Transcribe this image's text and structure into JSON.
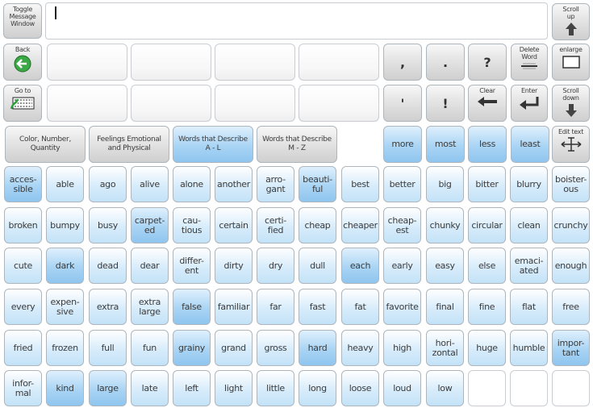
{
  "message": {
    "text": ""
  },
  "controls": {
    "toggle_message_window": {
      "label": "Toggle\nMessage\nWindow",
      "icon": "none"
    },
    "back": {
      "label": "Back",
      "icon": "back-arrow-icon"
    },
    "go_to_keyboard": {
      "label": "Go to",
      "icon": "keyboard-icon"
    },
    "scroll_up": {
      "label": "Scroll\nup",
      "icon": "up-arrow-icon"
    },
    "delete_word": {
      "label": "Delete\nWord",
      "icon": "delete-word-icon"
    },
    "enlarge": {
      "label": "enlarge",
      "icon": "enlarge-window-icon"
    },
    "clear": {
      "label": "Clear",
      "icon": "clear-arrow-icon"
    },
    "enter": {
      "label": "Enter",
      "icon": "enter-arrow-icon"
    },
    "scroll_down": {
      "label": "Scroll\ndown",
      "icon": "down-arrow-icon"
    },
    "edit_text": {
      "label": "Edit text",
      "icon": "text-cursor-icon"
    }
  },
  "punctuation": [
    ",",
    ".",
    "?",
    "'",
    "!"
  ],
  "categories": [
    {
      "label": "Color, Number,\nQuantity",
      "selected": false
    },
    {
      "label": "Feelings Emotional\nand Physical",
      "selected": false
    },
    {
      "label": "Words that Describe\nA - L",
      "selected": true
    },
    {
      "label": "Words that Describe\nM - Z",
      "selected": false
    }
  ],
  "comparatives": [
    "more",
    "most",
    "less",
    "least"
  ],
  "word_grid": [
    [
      {
        "w": "acces-\nsible",
        "s": true
      },
      {
        "w": "able",
        "s": false
      },
      {
        "w": "ago",
        "s": false
      },
      {
        "w": "alive",
        "s": false
      },
      {
        "w": "alone",
        "s": false
      },
      {
        "w": "another",
        "s": false
      },
      {
        "w": "arro-\ngant",
        "s": false
      },
      {
        "w": "beauti-\nful",
        "s": true
      },
      {
        "w": "best",
        "s": false
      },
      {
        "w": "better",
        "s": false
      },
      {
        "w": "big",
        "s": false
      },
      {
        "w": "bitter",
        "s": false
      },
      {
        "w": "blurry",
        "s": false
      },
      {
        "w": "boister-\nous",
        "s": false
      }
    ],
    [
      {
        "w": "broken",
        "s": false
      },
      {
        "w": "bumpy",
        "s": false
      },
      {
        "w": "busy",
        "s": false
      },
      {
        "w": "carpet-\ned",
        "s": true
      },
      {
        "w": "cau-\ntious",
        "s": false
      },
      {
        "w": "certain",
        "s": false
      },
      {
        "w": "certi-\nfied",
        "s": false
      },
      {
        "w": "cheap",
        "s": false
      },
      {
        "w": "cheaper",
        "s": false
      },
      {
        "w": "cheap-\nest",
        "s": false
      },
      {
        "w": "chunky",
        "s": false
      },
      {
        "w": "circular",
        "s": false
      },
      {
        "w": "clean",
        "s": false
      },
      {
        "w": "crunchy",
        "s": false
      }
    ],
    [
      {
        "w": "cute",
        "s": false
      },
      {
        "w": "dark",
        "s": true
      },
      {
        "w": "dead",
        "s": false
      },
      {
        "w": "dear",
        "s": false
      },
      {
        "w": "differ-\nent",
        "s": false
      },
      {
        "w": "dirty",
        "s": false
      },
      {
        "w": "dry",
        "s": false
      },
      {
        "w": "dull",
        "s": false
      },
      {
        "w": "each",
        "s": true
      },
      {
        "w": "early",
        "s": false
      },
      {
        "w": "easy",
        "s": false
      },
      {
        "w": "else",
        "s": false
      },
      {
        "w": "emaci-\nated",
        "s": false
      },
      {
        "w": "enough",
        "s": false
      }
    ],
    [
      {
        "w": "every",
        "s": false
      },
      {
        "w": "expen-\nsive",
        "s": false
      },
      {
        "w": "extra",
        "s": false
      },
      {
        "w": "extra\nlarge",
        "s": false
      },
      {
        "w": "false",
        "s": true
      },
      {
        "w": "familiar",
        "s": false
      },
      {
        "w": "far",
        "s": false
      },
      {
        "w": "fast",
        "s": false
      },
      {
        "w": "fat",
        "s": false
      },
      {
        "w": "favorite",
        "s": false
      },
      {
        "w": "final",
        "s": false
      },
      {
        "w": "fine",
        "s": false
      },
      {
        "w": "flat",
        "s": false
      },
      {
        "w": "free",
        "s": false
      }
    ],
    [
      {
        "w": "fried",
        "s": false
      },
      {
        "w": "frozen",
        "s": false
      },
      {
        "w": "full",
        "s": false
      },
      {
        "w": "fun",
        "s": false
      },
      {
        "w": "grainy",
        "s": true
      },
      {
        "w": "grand",
        "s": false
      },
      {
        "w": "gross",
        "s": false
      },
      {
        "w": "hard",
        "s": true
      },
      {
        "w": "heavy",
        "s": false
      },
      {
        "w": "high",
        "s": false
      },
      {
        "w": "hori-\nzontal",
        "s": false
      },
      {
        "w": "huge",
        "s": false
      },
      {
        "w": "humble",
        "s": false
      },
      {
        "w": "impor-\ntant",
        "s": true
      }
    ],
    [
      {
        "w": "infor-\nmal",
        "s": false
      },
      {
        "w": "kind",
        "s": true
      },
      {
        "w": "large",
        "s": true
      },
      {
        "w": "late",
        "s": false
      },
      {
        "w": "left",
        "s": false
      },
      {
        "w": "light",
        "s": false
      },
      {
        "w": "little",
        "s": false
      },
      {
        "w": "long",
        "s": false
      },
      {
        "w": "loose",
        "s": false
      },
      {
        "w": "loud",
        "s": false
      },
      {
        "w": "low",
        "s": false
      },
      {
        "w": "",
        "s": false,
        "empty": true
      },
      {
        "w": "",
        "s": false,
        "empty": true
      },
      {
        "w": "",
        "s": false,
        "empty": true
      }
    ]
  ],
  "colors": {
    "selected_cell": "#a9d4f4",
    "cell": "#d7ecfb",
    "control": "#dedede"
  }
}
